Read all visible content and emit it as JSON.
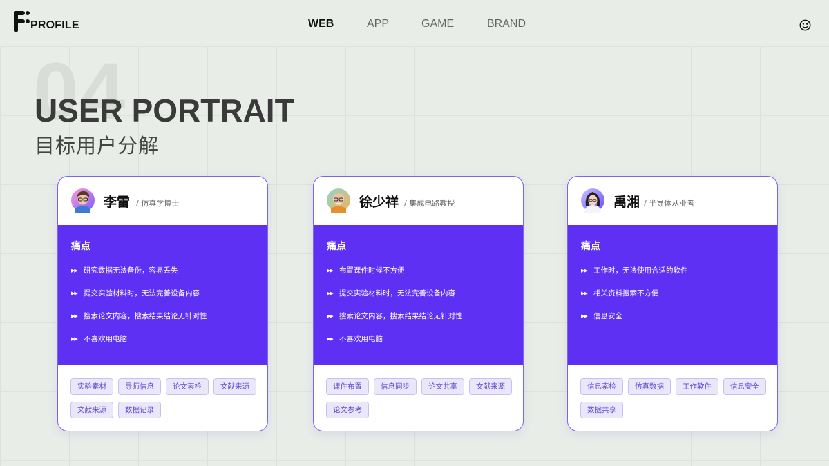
{
  "brand": {
    "name": "PROFILE"
  },
  "nav": {
    "items": [
      {
        "label": "WEB",
        "active": true
      },
      {
        "label": "APP",
        "active": false
      },
      {
        "label": "GAME",
        "active": false
      },
      {
        "label": "BRAND",
        "active": false
      }
    ]
  },
  "header_icons": [
    "face-icon"
  ],
  "hero": {
    "number": "04",
    "title": "USER PORTRAIT",
    "subtitle": "目标用户分解"
  },
  "colors": {
    "accent": "#5d30f4",
    "card_border": "#7b64f0",
    "tag_bg": "#ebe7fb",
    "tag_text": "#5b4ad0"
  },
  "cards": [
    {
      "name": "李雷",
      "role": "/ 仿真学博士",
      "pain_title": "痛点",
      "pains": [
        "研究数据无法备份，容易丢失",
        "提交实验材料时，无法完善设备内容",
        "搜索论文内容，搜索结果结论无针对性",
        "不喜欢用电脑"
      ],
      "tags": [
        "实验素材",
        "导师信息",
        "论文索检",
        "文献来源",
        "文献来源",
        "数据记录"
      ]
    },
    {
      "name": "徐少祥",
      "role": "/ 集成电路教授",
      "pain_title": "痛点",
      "pains": [
        "布置课件时候不方便",
        "提交实验材料时，无法完善设备内容",
        "搜索论文内容，搜索结果结论无针对性",
        "不喜欢用电脑"
      ],
      "tags": [
        "课件布置",
        "信息同步",
        "论文共享",
        "文献来源",
        "论文参考"
      ]
    },
    {
      "name": "禹湘",
      "role": "/ 半导体从业者",
      "pain_title": "痛点",
      "pains": [
        "工作时，无法使用合适的软件",
        "相关资料搜索不方便",
        "信息安全"
      ],
      "tags": [
        "信息索检",
        "仿真数据",
        "工作软件",
        "信息安全",
        "数据共享"
      ]
    }
  ],
  "bullet_glyph": "▶▶"
}
